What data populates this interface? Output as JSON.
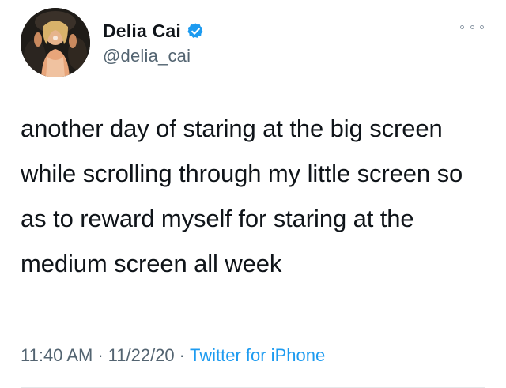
{
  "author": {
    "display_name": "Delia Cai",
    "handle": "@delia_cai",
    "verified": true
  },
  "tweet": {
    "text": "another day of staring at the big screen while scrolling through my little screen so as to reward myself for staring at the medium screen all week",
    "time": "11:40 AM",
    "date": "11/22/20",
    "separator": "·",
    "source": "Twitter for iPhone"
  },
  "icons": {
    "verified": "verified-badge-icon",
    "more": "more-options-icon"
  },
  "colors": {
    "text": "#0f1419",
    "secondary": "#536471",
    "accent": "#1d9bf0"
  }
}
